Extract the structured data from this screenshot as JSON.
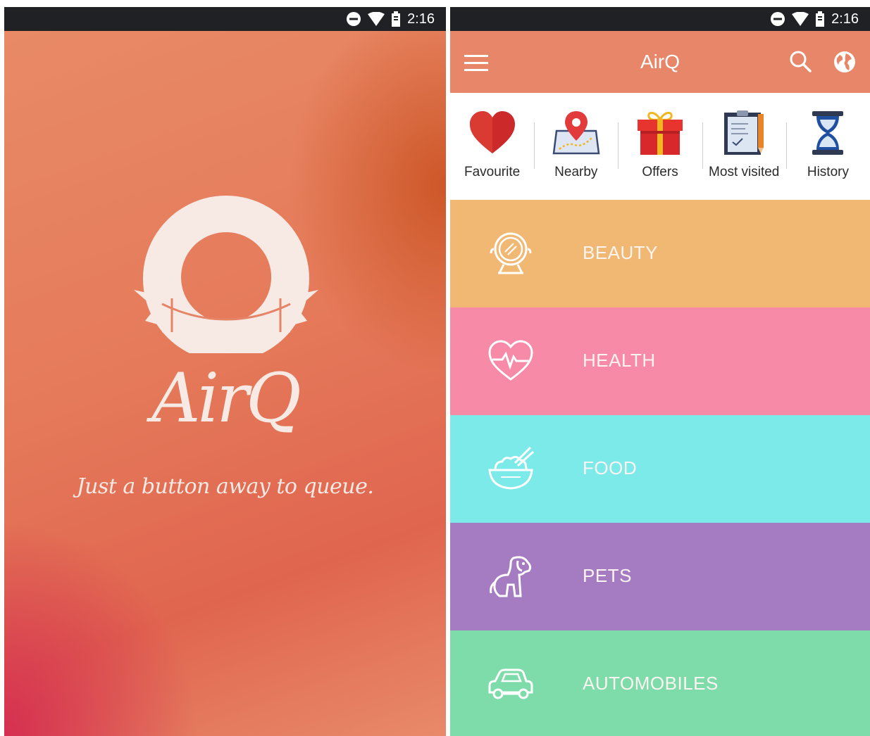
{
  "status_bar": {
    "time": "2:16"
  },
  "splash": {
    "app_name": "AirQ",
    "tagline": "Just a button away to queue.",
    "colors": {
      "top": "#e88a66",
      "accent_right": "#c9501e",
      "bottom_left": "#d42850",
      "logo": "#f7eae4"
    }
  },
  "home": {
    "appbar": {
      "title": "AirQ",
      "menu_icon": "hamburger-menu-icon",
      "search_icon": "search-icon",
      "language_icon": "globe-icon",
      "color": "#e8866a"
    },
    "quick_actions": [
      {
        "label": "Favourite",
        "icon": "heart-icon"
      },
      {
        "label": "Nearby",
        "icon": "map-pin-icon"
      },
      {
        "label": "Offers",
        "icon": "gift-icon"
      },
      {
        "label": "Most visited",
        "icon": "clipboard-icon"
      },
      {
        "label": "History",
        "icon": "hourglass-icon"
      }
    ],
    "categories": [
      {
        "label": "BEAUTY",
        "icon": "mirror-icon",
        "color": "#f0b872"
      },
      {
        "label": "HEALTH",
        "icon": "heartbeat-icon",
        "color": "#f78aa7"
      },
      {
        "label": "FOOD",
        "icon": "rice-bowl-icon",
        "color": "#7deaea"
      },
      {
        "label": "PETS",
        "icon": "dog-icon",
        "color": "#a57cc2"
      },
      {
        "label": "AUTOMOBILES",
        "icon": "car-icon",
        "color": "#7ddcaa"
      }
    ]
  }
}
